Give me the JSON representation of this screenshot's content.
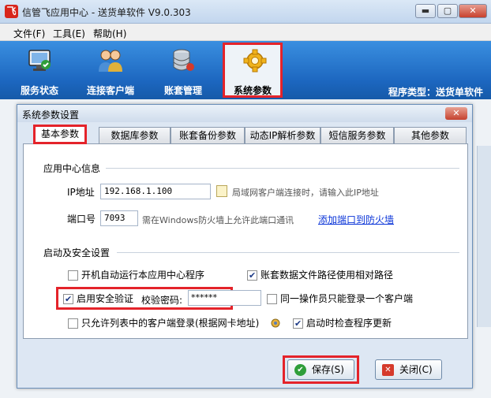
{
  "window": {
    "title": "信管飞应用中心 - 送货单软件 V9.0.303",
    "icon_letter": "飞",
    "min_label": "▬",
    "max_label": "▢",
    "close_label": "✕"
  },
  "menu": {
    "items": [
      "文件(F)",
      "工具(E)",
      "帮助(H)"
    ]
  },
  "toolbar": {
    "items": [
      {
        "label": "服务状态",
        "icon": "monitor-check-icon"
      },
      {
        "label": "连接客户端",
        "icon": "users-icon"
      },
      {
        "label": "账套管理",
        "icon": "database-icon"
      },
      {
        "label": "系统参数",
        "icon": "gear-icon"
      }
    ],
    "active": "系统参数",
    "program_type": "程序类型：送货单软件"
  },
  "dialog": {
    "title": "系统参数设置",
    "close_label": "✕",
    "tabs": [
      "基本参数",
      "数据库参数",
      "账套备份参数",
      "动态IP解析参数",
      "短信服务参数",
      "其他参数"
    ],
    "active_tab": "基本参数",
    "app_center_group": "应用中心信息",
    "ip_label": "IP地址",
    "ip_value": "192.168.1.100",
    "ip_hint": "局域网客户端连接时，请输入此IP地址",
    "port_label": "端口号",
    "port_value": "7093",
    "port_hint": "需在Windows防火墙上允许此端口通讯",
    "firewall_link": "添加端口到防火墙",
    "security_group": "启动及安全设置",
    "auto_start": {
      "label": "开机自动运行本应用中心程序",
      "checked": false
    },
    "relative_path": {
      "label": "账套数据文件路径使用相对路径",
      "checked": true
    },
    "enable_security": {
      "label": "启用安全验证",
      "checked": true
    },
    "verify_pwd_label": "校验密码:",
    "verify_pwd_value": "******",
    "single_login": {
      "label": "同一操作员只能登录一个客户端",
      "checked": false
    },
    "whitelist": {
      "label": "只允许列表中的客户端登录(根据网卡地址)",
      "checked": false
    },
    "check_update": {
      "label": "启动时检查程序更新",
      "checked": true
    },
    "save_label": "保存(S)",
    "close_button_label": "关闭(C)"
  },
  "colors": {
    "toolbar_blue": "#1c66bf",
    "highlight_red": "#e4232a",
    "link_blue": "#0a34d8"
  }
}
